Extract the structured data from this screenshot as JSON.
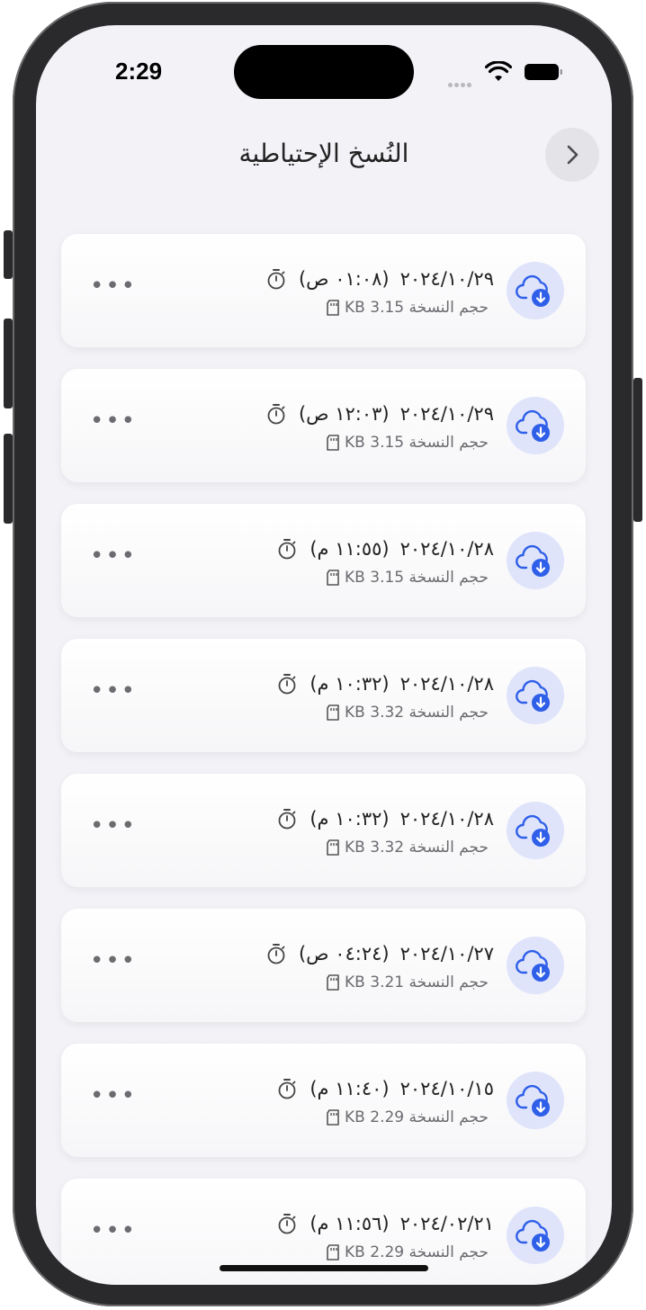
{
  "status": {
    "time": "2:29"
  },
  "header": {
    "title": "النُسخ الإحتياطية",
    "back_icon": "chevron-right-icon"
  },
  "backups": [
    {
      "date": "٢٠٢٤/١٠/٢٩",
      "time": "(٠١:٠٨ ص)",
      "size": "حجم النسخة 3.15 KB"
    },
    {
      "date": "٢٠٢٤/١٠/٢٩",
      "time": "(١٢:٠٣ ص)",
      "size": "حجم النسخة 3.15 KB"
    },
    {
      "date": "٢٠٢٤/١٠/٢٨",
      "time": "(١١:٥٥ م)",
      "size": "حجم النسخة 3.15 KB"
    },
    {
      "date": "٢٠٢٤/١٠/٢٨",
      "time": "(١٠:٣٢ م)",
      "size": "حجم النسخة 3.32 KB"
    },
    {
      "date": "٢٠٢٤/١٠/٢٨",
      "time": "(١٠:٣٢ م)",
      "size": "حجم النسخة 3.32 KB"
    },
    {
      "date": "٢٠٢٤/١٠/٢٧",
      "time": "(٠٤:٢٤ ص)",
      "size": "حجم النسخة 3.21 KB"
    },
    {
      "date": "٢٠٢٤/١٠/١٥",
      "time": "(١١:٤٠ م)",
      "size": "حجم النسخة 2.29 KB"
    },
    {
      "date": "٢٠٢٤/٠٢/٢١",
      "time": "(١١:٥٦ م)",
      "size": "حجم النسخة 2.29 KB"
    }
  ],
  "more_label": "•••",
  "colors": {
    "accent": "#2f5fe8",
    "avatar_bg": "#dfe4fb",
    "background": "#f2f2f7"
  }
}
